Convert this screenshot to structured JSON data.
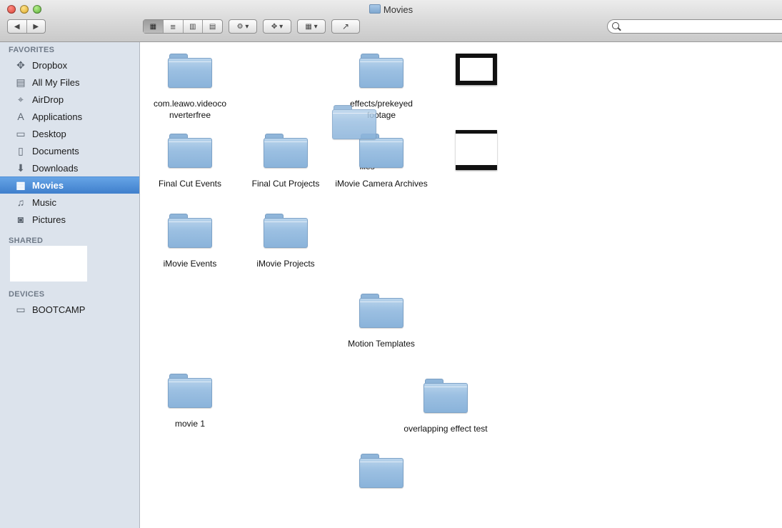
{
  "window": {
    "title": "Movies"
  },
  "toolbar": {
    "back": "◀",
    "forward": "▶",
    "view_icon": "▦",
    "view_list": "≡",
    "view_columns": "▥",
    "view_coverflow": "▤",
    "action": "⚙ ▾",
    "dropbox": "✥ ▾",
    "arrange": "▦ ▾",
    "share": "↗"
  },
  "search": {
    "placeholder": ""
  },
  "sidebar": {
    "favorites_header": "FAVORITES",
    "shared_header": "SHARED",
    "devices_header": "DEVICES",
    "favorites": [
      {
        "label": "Dropbox",
        "icon": "✥"
      },
      {
        "label": "All My Files",
        "icon": "▤"
      },
      {
        "label": "AirDrop",
        "icon": "⌖"
      },
      {
        "label": "Applications",
        "icon": "A"
      },
      {
        "label": "Desktop",
        "icon": "▭"
      },
      {
        "label": "Documents",
        "icon": "▯"
      },
      {
        "label": "Downloads",
        "icon": "⬇"
      },
      {
        "label": "Movies",
        "icon": "▦"
      },
      {
        "label": "Music",
        "icon": "♫"
      },
      {
        "label": "Pictures",
        "icon": "◙"
      }
    ],
    "devices": [
      {
        "label": "BOOTCAMP",
        "icon": "▭"
      }
    ]
  },
  "items": [
    {
      "label": "com.leawo.videoco nverterfree"
    },
    {
      "label": "effects/prekeyed footage"
    },
    {
      "label": "Final Cut Events"
    },
    {
      "label": "Final Cut Projects"
    },
    {
      "label": "iMovie Camera Archives"
    },
    {
      "label": "iMovie Events"
    },
    {
      "label": "iMovie Projects"
    },
    {
      "label": "Motion Templates"
    },
    {
      "label": "movie 1"
    },
    {
      "label": "overlapping effect test"
    },
    {
      "label": "files"
    }
  ]
}
